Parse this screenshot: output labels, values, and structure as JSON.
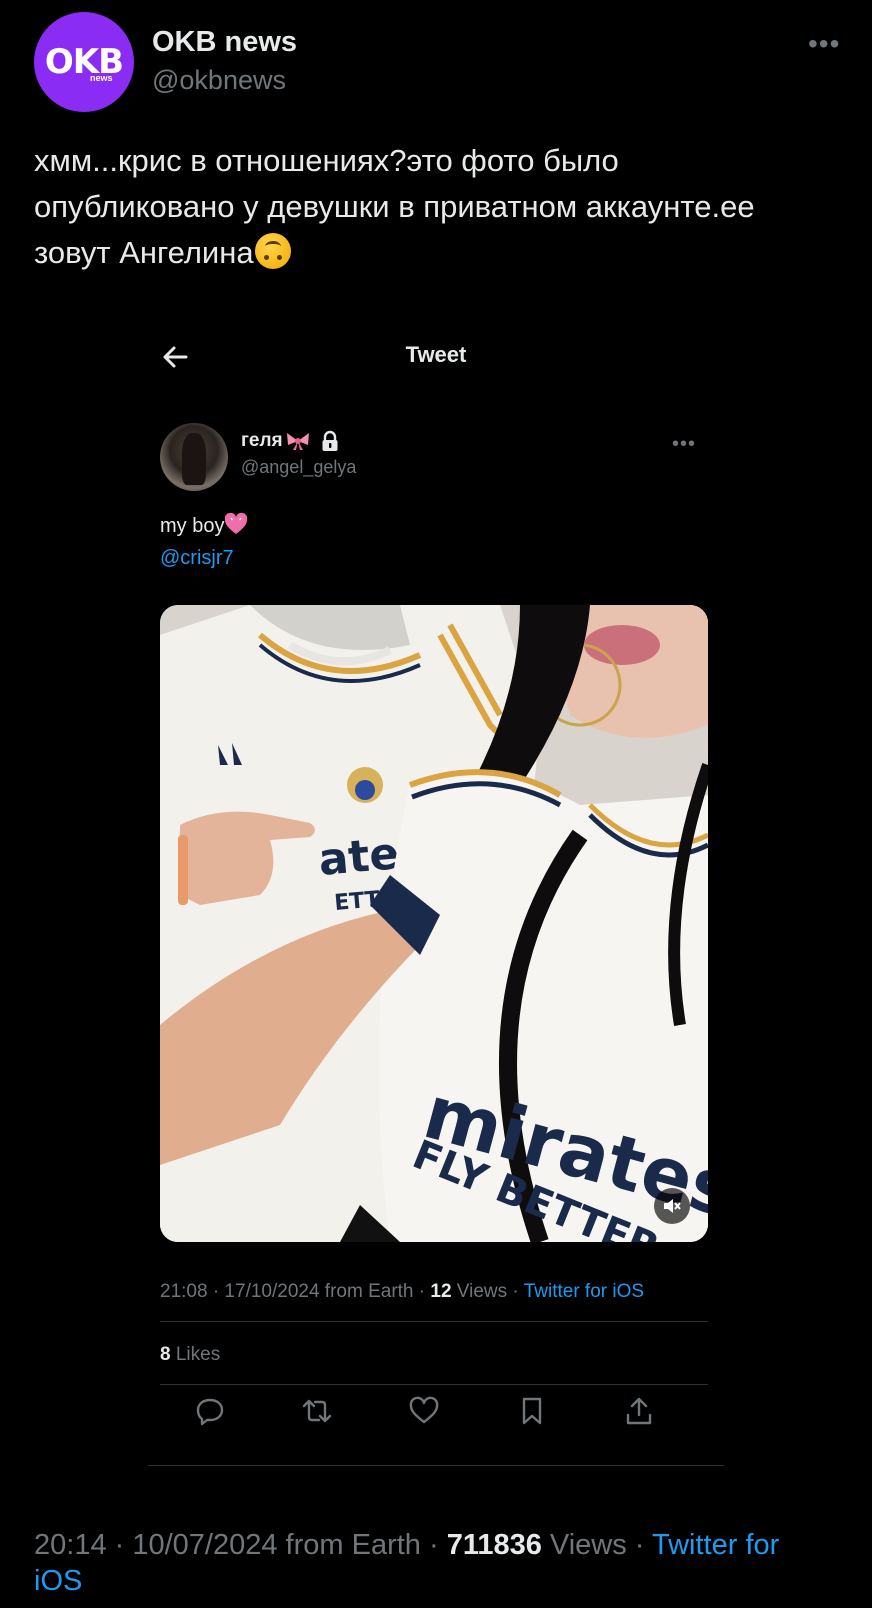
{
  "author": {
    "logo_text": "OKB",
    "logo_sub": "news",
    "display_name": "OKB news",
    "handle": "@okbnews"
  },
  "tweet": {
    "text": "хмм...крис в отношениях?это фото было опубликовано у девушки в приватном аккаунте.ее зовут Ангелина"
  },
  "embedded": {
    "header_title": "Tweet",
    "author": {
      "display_name": "геля",
      "handle": "@angel_gelya"
    },
    "text": "my boy",
    "mention": "@crisjr7",
    "meta": {
      "time": "21:08 · 17/10/2024 from Earth · ",
      "views_count": "12",
      "views_label": " Views · ",
      "source": "Twitter for iOS"
    },
    "likes_count": "8",
    "likes_label": " Likes"
  },
  "footer": {
    "time": "20:14 · 10/07/2024 from Earth · ",
    "views_count": "711836",
    "views_label": " Views · ",
    "source": "Twitter for iOS"
  },
  "colors": {
    "accent": "#1d9bf0",
    "brand": "#8b2cf5",
    "background": "#000000",
    "muted": "#71767b"
  }
}
